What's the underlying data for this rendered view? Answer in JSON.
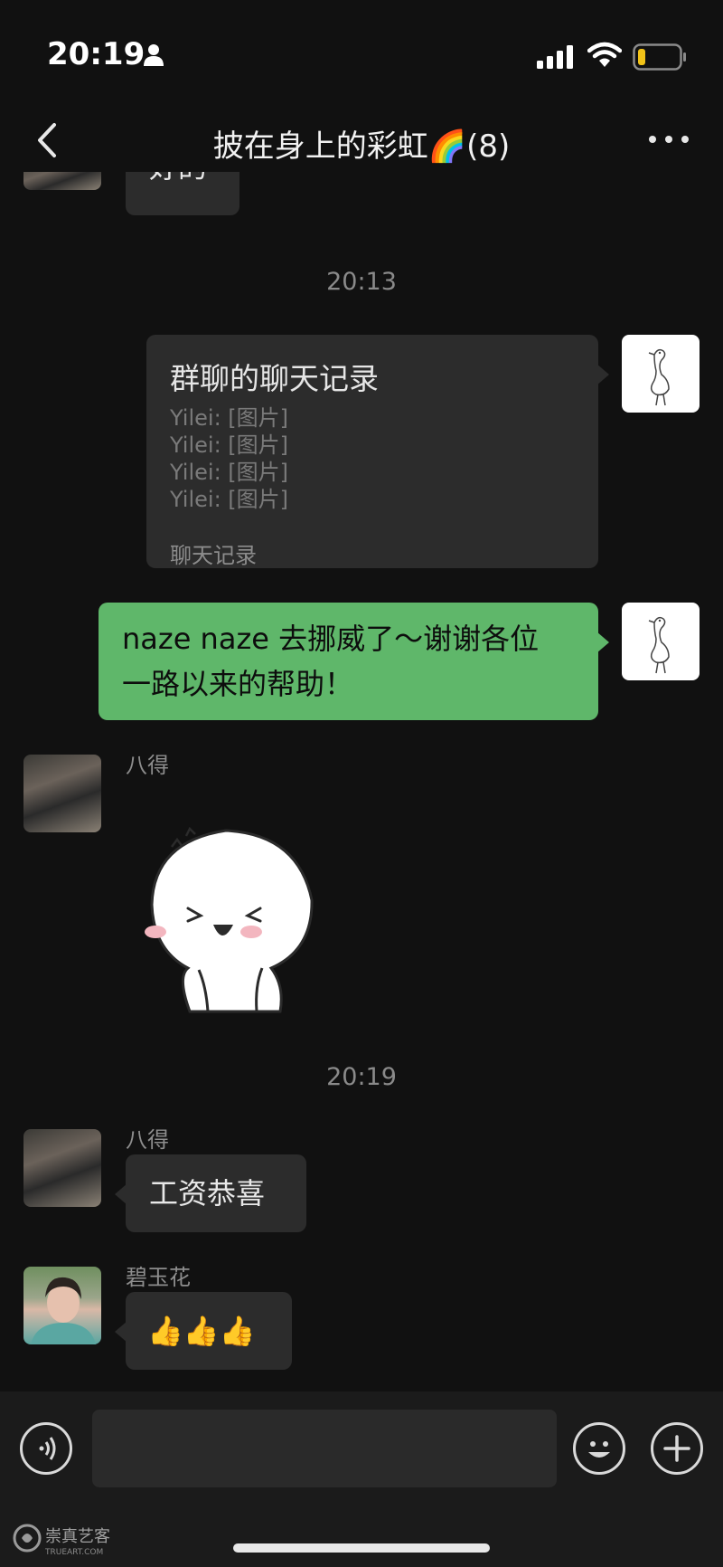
{
  "status_bar": {
    "time": "20:19"
  },
  "nav": {
    "title": "披在身上的彩虹🌈(8)"
  },
  "messages": {
    "top_partial_text": "好的",
    "timestamp_1": "20:13",
    "chat_record": {
      "title": "群聊的聊天记录",
      "lines": [
        "Yilei: [图片]",
        "Yilei: [图片]",
        "Yilei: [图片]",
        "Yilei: [图片]"
      ],
      "footer": "聊天记录"
    },
    "self_text_line1": "naze naze 去挪威了～谢谢各位",
    "self_text_line2": "一路以来的帮助！",
    "sender_bade": "八得",
    "timestamp_2": "20:19",
    "bade_text": "工资恭喜",
    "sender_biyu": "碧玉花",
    "biyu_text": "👍👍👍"
  },
  "watermark": {
    "name": "崇真艺客",
    "url": "TRUEART.COM"
  }
}
